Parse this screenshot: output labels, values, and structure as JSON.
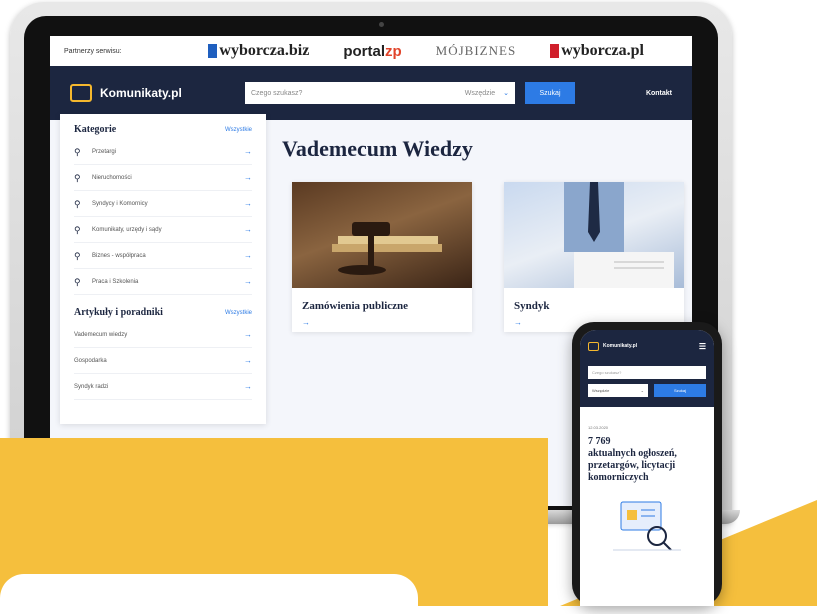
{
  "partners": {
    "label": "Partnerzy serwisu:",
    "logos": [
      "wyborcza.biz",
      "portal",
      "zp",
      "MÓJBIZNES",
      "wyborcza.pl"
    ]
  },
  "nav": {
    "brand": "Komunikaty.pl",
    "search_placeholder": "Czego szukasz?",
    "scope": "Wszędzie",
    "search_button": "Szukaj",
    "contact": "Kontakt"
  },
  "sidebar": {
    "categories_title": "Kategorie",
    "categories_all": "Wszystkie",
    "categories": [
      {
        "label": "Przetargi",
        "icon": "gavel-icon"
      },
      {
        "label": "Nieruchomości",
        "icon": "gavel-icon"
      },
      {
        "label": "Syndycy i Komornicy",
        "icon": "gavel-icon"
      },
      {
        "label": "Komunikaty, urzędy i sądy",
        "icon": "gavel-icon"
      },
      {
        "label": "Biznes - współpraca",
        "icon": "gavel-icon"
      },
      {
        "label": "Praca i Szkolenia",
        "icon": "gavel-icon"
      }
    ],
    "articles_title": "Artykuły i poradniki",
    "articles_all": "Wszystkie",
    "articles": [
      {
        "label": "Vademecum wiedzy"
      },
      {
        "label": "Gospodarka"
      },
      {
        "label": "Syndyk radzi"
      }
    ]
  },
  "main": {
    "title": "Vademecum Wiedzy",
    "cards": [
      {
        "title": "Zamówienia publiczne"
      },
      {
        "title": "Syndyk"
      }
    ]
  },
  "phone": {
    "brand": "Komunikaty.pl",
    "search_placeholder": "Czego szukasz?",
    "scope": "Wszędzie",
    "search_button": "Szukaj",
    "date": "12.03.2020",
    "count": "7 769",
    "text": "aktualnych ogłoszeń, przetargów, licytacji komorniczych"
  },
  "colors": {
    "navy": "#1c2640",
    "accent_blue": "#2d7be5",
    "yellow": "#f5bf3d",
    "logo_orange": "#f5b82e"
  }
}
